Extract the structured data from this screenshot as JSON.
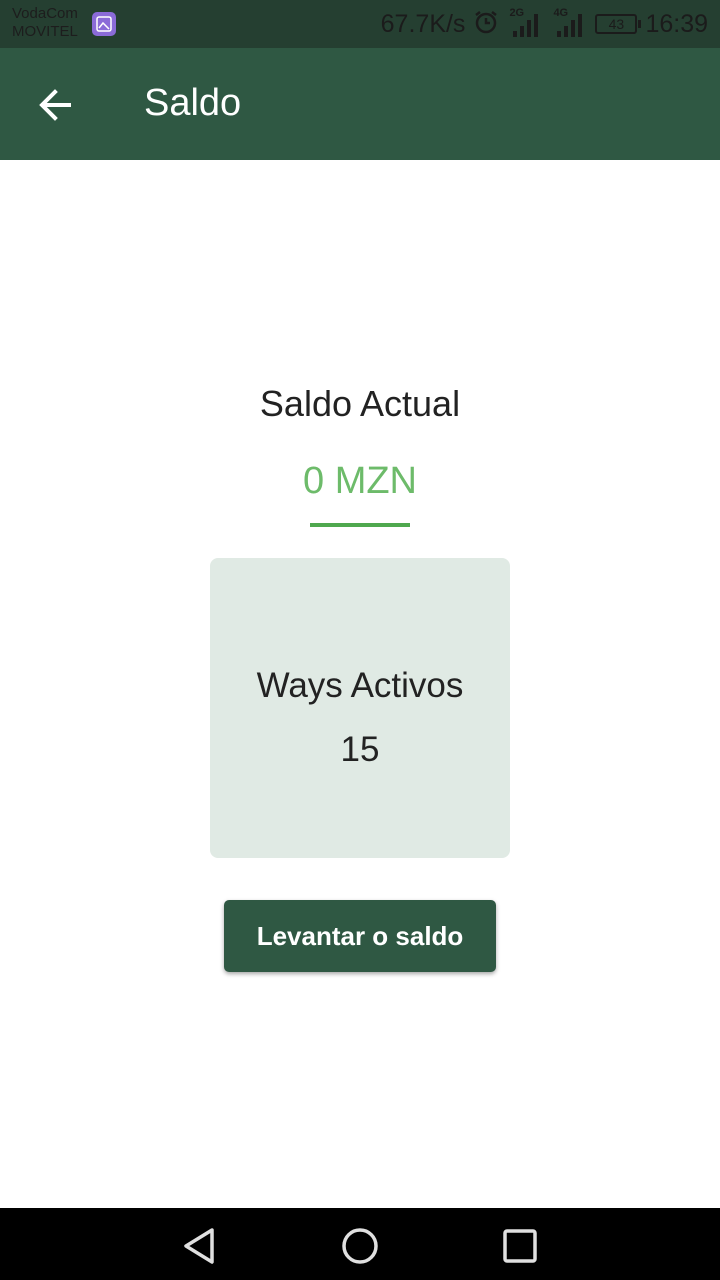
{
  "status_bar": {
    "carrier_primary": "VodaCom",
    "carrier_secondary": "MOVITEL",
    "net_speed": "67.7K/s",
    "sim1_tag": "2G",
    "sim2_tag": "4G",
    "battery": "43",
    "time": "16:39",
    "icons": [
      "gallery-icon",
      "alarm-icon",
      "signal-icon",
      "signal-icon",
      "battery-icon"
    ]
  },
  "app_bar": {
    "title": "Saldo",
    "back_icon": "arrow-left-icon",
    "background": "#2f5843"
  },
  "balance": {
    "heading": "Saldo Actual",
    "amount": "0 MZN",
    "amount_color": "#6dbb6a"
  },
  "card": {
    "label": "Ways Activos",
    "value": "15",
    "background": "#e0eae4"
  },
  "actions": {
    "withdraw_label": "Levantar o saldo"
  },
  "nav_bar": {
    "icons": [
      "back-triangle-icon",
      "home-circle-icon",
      "recents-square-icon"
    ]
  }
}
